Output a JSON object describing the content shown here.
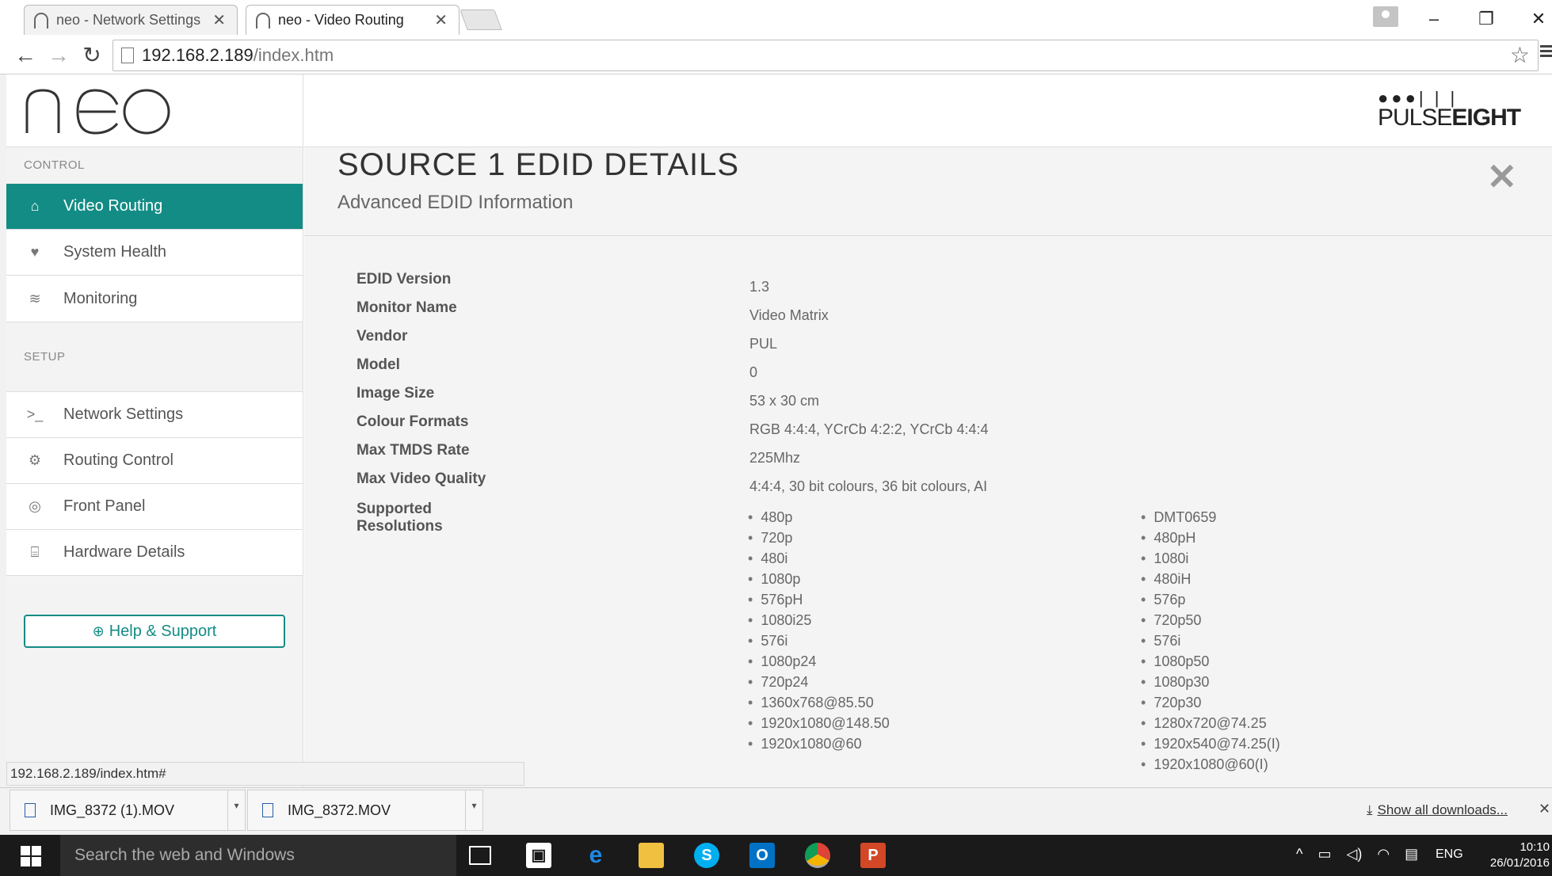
{
  "browser": {
    "tabs": [
      {
        "title": "neo - Network Settings",
        "active": false
      },
      {
        "title": "neo - Video Routing",
        "active": true
      }
    ],
    "url_host": "192.168.2.189",
    "url_path": "/index.htm",
    "status_url": "192.168.2.189/index.htm#"
  },
  "app": {
    "logo_text": "neo",
    "brand": {
      "dots": "●●●| |  |",
      "name_light": "PULSE",
      "name_bold": "EIGHT"
    },
    "sidebar": {
      "control_label": "CONTROL",
      "control_items": [
        {
          "label": "Video Routing",
          "icon": "home-icon",
          "glyph": "⌂",
          "active": true
        },
        {
          "label": "System Health",
          "icon": "heart-icon",
          "glyph": "♥",
          "active": false
        },
        {
          "label": "Monitoring",
          "icon": "rss-icon",
          "glyph": "≋",
          "active": false
        }
      ],
      "setup_label": "SETUP",
      "setup_items": [
        {
          "label": "Network Settings",
          "icon": "terminal-icon",
          "glyph": ">_"
        },
        {
          "label": "Routing Control",
          "icon": "cogs-icon",
          "glyph": "⚙"
        },
        {
          "label": "Front Panel",
          "icon": "target-icon",
          "glyph": "◎"
        },
        {
          "label": "Hardware Details",
          "icon": "hdd-icon",
          "glyph": "⌸"
        }
      ],
      "help_label": "Help & Support"
    },
    "detail": {
      "title": "SOURCE 1 EDID DETAILS",
      "subtitle": "Advanced EDID Information",
      "rows": [
        {
          "key": "EDID Version",
          "value": "1.3"
        },
        {
          "key": "Monitor Name",
          "value": "Video Matrix"
        },
        {
          "key": "Vendor",
          "value": "PUL"
        },
        {
          "key": "Model",
          "value": "0"
        },
        {
          "key": "Image Size",
          "value": "53 x 30 cm"
        },
        {
          "key": "Colour Formats",
          "value": "RGB 4:4:4, YCrCb 4:2:2, YCrCb 4:4:4"
        },
        {
          "key": "Max TMDS Rate",
          "value": "225Mhz"
        },
        {
          "key": "Max Video Quality",
          "value": "4:4:4, 30 bit colours, 36 bit colours, AI"
        }
      ],
      "resolutions_label": "Supported Resolutions",
      "resolutions_col1": [
        "480p",
        "720p",
        "480i",
        "1080p",
        "576pH",
        "1080i25",
        "576i",
        "1080p24",
        "720p24",
        "1360x768@85.50",
        "1920x1080@148.50",
        "1920x1080@60"
      ],
      "resolutions_col2": [
        "DMT0659",
        "480pH",
        "1080i",
        "480iH",
        "576p",
        "720p50",
        "576i",
        "1080p50",
        "1080p30",
        "720p30",
        "1280x720@74.25",
        "1920x540@74.25(I)",
        "1920x1080@60(I)"
      ]
    }
  },
  "downloads": {
    "items": [
      "IMG_8372 (1).MOV",
      "IMG_8372.MOV"
    ],
    "show_all": "Show all downloads..."
  },
  "taskbar": {
    "search_placeholder": "Search the web and Windows",
    "language": "ENG",
    "time": "10:10",
    "date": "26/01/2016"
  }
}
